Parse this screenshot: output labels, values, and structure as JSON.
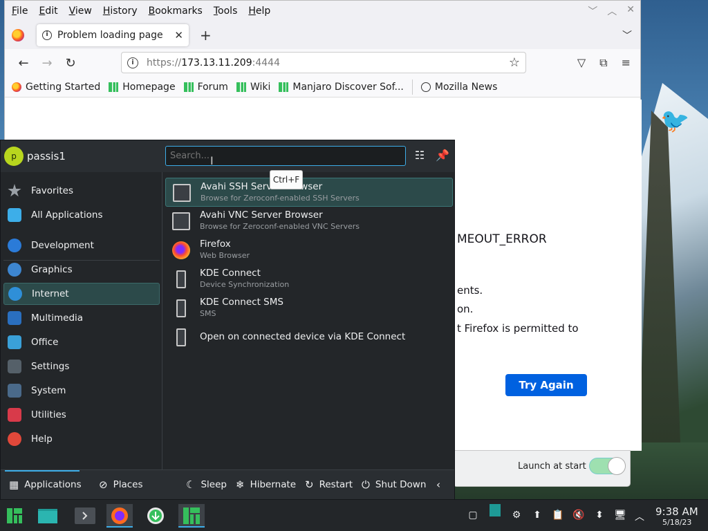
{
  "browser": {
    "menu": [
      "File",
      "Edit",
      "View",
      "History",
      "Bookmarks",
      "Tools",
      "Help"
    ],
    "tab_title": "Problem loading page",
    "url": {
      "proto": "https://",
      "host": "173.13.11.209",
      "port": ":4444"
    },
    "bookmarks": [
      "Getting Started",
      "Homepage",
      "Forum",
      "Wiki",
      "Manjaro Discover Sof...",
      "Mozilla News"
    ]
  },
  "page": {
    "error_code": "MEOUT_ERROR",
    "line1": "ents.",
    "line2": "on.",
    "line3": "t Firefox is permitted to",
    "try_again": "Try Again"
  },
  "dialog": {
    "launch_label": "Launch at start",
    "toggle_on": true
  },
  "launcher": {
    "user": "passis1",
    "avatar_letter": "p",
    "search_placeholder": "Search...",
    "tooltip": "Ctrl+F",
    "categories": [
      {
        "label": "Favorites",
        "icon": "star-icon",
        "color": "#9aa0a6"
      },
      {
        "label": "All Applications",
        "icon": "grid-icon",
        "color": "#3daee9"
      },
      {
        "label": "Development",
        "icon": "development-icon",
        "color": "#2b7bd8"
      },
      {
        "label": "Graphics",
        "icon": "graphics-icon",
        "color": "#3d86d0"
      },
      {
        "label": "Internet",
        "icon": "globe-icon",
        "color": "#2f8fd8"
      },
      {
        "label": "Multimedia",
        "icon": "multimedia-icon",
        "color": "#2a6fbf"
      },
      {
        "label": "Office",
        "icon": "office-icon",
        "color": "#3aa0d8"
      },
      {
        "label": "Settings",
        "icon": "settings-icon",
        "color": "#556069"
      },
      {
        "label": "System",
        "icon": "system-icon",
        "color": "#4a6a8a"
      },
      {
        "label": "Utilities",
        "icon": "utilities-icon",
        "color": "#d83a4a"
      },
      {
        "label": "Help",
        "icon": "help-icon",
        "color": "#e0483a"
      }
    ],
    "results": [
      {
        "title": "Avahi SSH Server Browser",
        "subtitle": "Browse for Zeroconf-enabled SSH Servers",
        "icon": "monitor-icon"
      },
      {
        "title": "Avahi VNC Server Browser",
        "subtitle": "Browse for Zeroconf-enabled VNC Servers",
        "icon": "monitor-icon"
      },
      {
        "title": "Firefox",
        "subtitle": "Web Browser",
        "icon": "firefox-icon"
      },
      {
        "title": "KDE Connect",
        "subtitle": "Device Synchronization",
        "icon": "phone-icon"
      },
      {
        "title": "KDE Connect SMS",
        "subtitle": "SMS",
        "icon": "phone-icon"
      },
      {
        "title": "Open on connected device via KDE Connect",
        "subtitle": "",
        "icon": "phone-icon"
      }
    ],
    "footer": {
      "applications": "Applications",
      "places": "Places",
      "sleep": "Sleep",
      "hibernate": "Hibernate",
      "restart": "Restart",
      "shutdown": "Shut Down"
    }
  },
  "taskbar": {
    "time": "9:38 AM",
    "date": "5/18/23"
  }
}
